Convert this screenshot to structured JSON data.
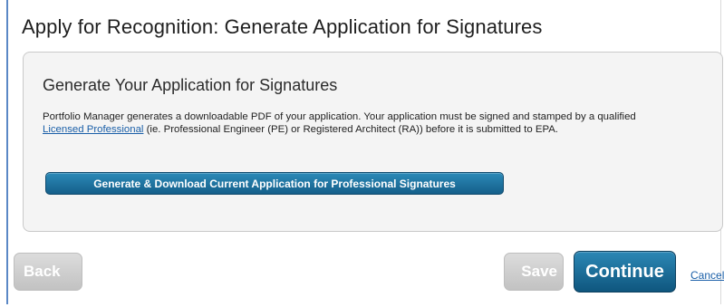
{
  "page": {
    "title": "Apply for Recognition: Generate Application for Signatures"
  },
  "panel": {
    "title": "Generate Your Application for Signatures",
    "description_before_link": "Portfolio Manager generates a downloadable PDF of your application. Your application must be signed and stamped by a qualified ",
    "link_text": "Licensed Professional",
    "description_after_link": " (ie. Professional Engineer (PE) or Registered Architect (RA)) before it is submitted to EPA.",
    "generate_button_label": "Generate & Download Current Application for Professional Signatures"
  },
  "actions": {
    "back_label": "Back",
    "save_label": "Save",
    "continue_label": "Continue",
    "cancel_label": "Cancel"
  },
  "colors": {
    "primary_button": "#155f8a",
    "disabled_button": "#c8c8c8",
    "link": "#1a5fa8",
    "frame_border": "#5a88c6"
  }
}
